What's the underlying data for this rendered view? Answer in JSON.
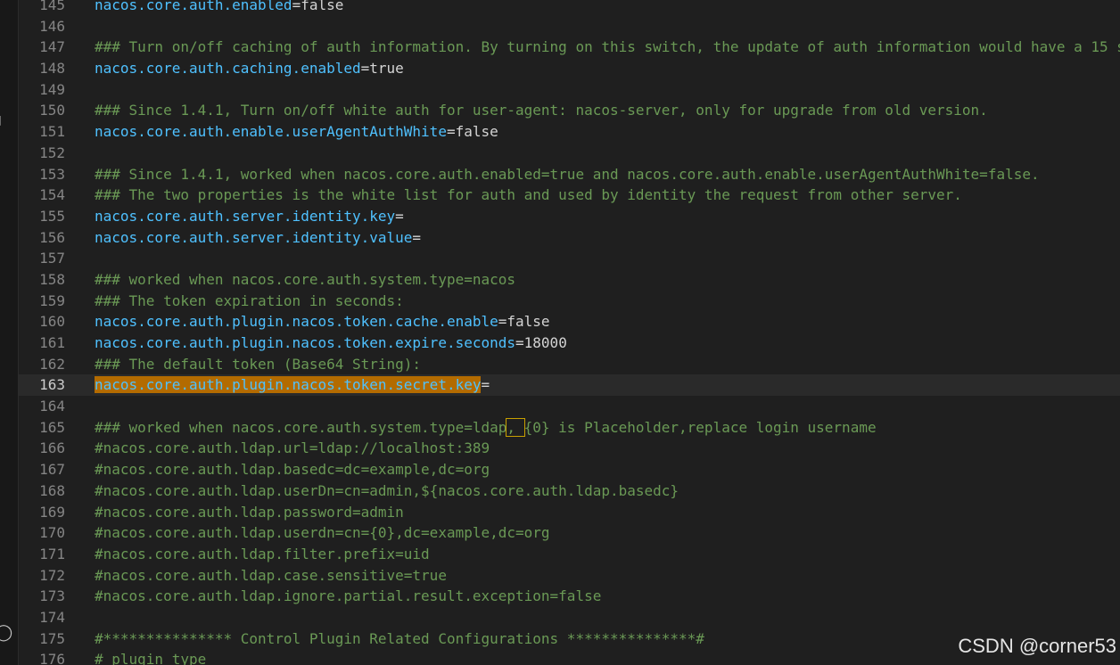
{
  "editor": {
    "current_line": "163",
    "lines": [
      {
        "n": "145",
        "parts": [
          {
            "t": "nacos.core.auth.enabled",
            "c": "k"
          },
          {
            "t": "=",
            "c": "eq"
          },
          {
            "t": "false",
            "c": "v"
          }
        ]
      },
      {
        "n": "146",
        "parts": []
      },
      {
        "n": "147",
        "parts": [
          {
            "t": "### Turn on/off caching of auth information. By turning on this switch, the update of auth information would have a 15 s",
            "c": "cm"
          }
        ]
      },
      {
        "n": "148",
        "parts": [
          {
            "t": "nacos.core.auth.caching.enabled",
            "c": "k"
          },
          {
            "t": "=",
            "c": "eq"
          },
          {
            "t": "true",
            "c": "v"
          }
        ]
      },
      {
        "n": "149",
        "parts": []
      },
      {
        "n": "150",
        "parts": [
          {
            "t": "### Since 1.4.1, Turn on/off white auth for user-agent: nacos-server, only for upgrade from old version.",
            "c": "cm"
          }
        ]
      },
      {
        "n": "151",
        "parts": [
          {
            "t": "nacos.core.auth.enable.userAgentAuthWhite",
            "c": "k"
          },
          {
            "t": "=",
            "c": "eq"
          },
          {
            "t": "false",
            "c": "v"
          }
        ]
      },
      {
        "n": "152",
        "parts": []
      },
      {
        "n": "153",
        "parts": [
          {
            "t": "### Since 1.4.1, worked when nacos.core.auth.enabled=true and nacos.core.auth.enable.userAgentAuthWhite=false.",
            "c": "cm"
          }
        ]
      },
      {
        "n": "154",
        "parts": [
          {
            "t": "### The two properties is the white list for auth and used by identity the request from other server.",
            "c": "cm"
          }
        ]
      },
      {
        "n": "155",
        "parts": [
          {
            "t": "nacos.core.auth.server.identity.key",
            "c": "k"
          },
          {
            "t": "=",
            "c": "eq"
          }
        ]
      },
      {
        "n": "156",
        "parts": [
          {
            "t": "nacos.core.auth.server.identity.value",
            "c": "k"
          },
          {
            "t": "=",
            "c": "eq"
          }
        ]
      },
      {
        "n": "157",
        "parts": []
      },
      {
        "n": "158",
        "parts": [
          {
            "t": "### worked when nacos.core.auth.system.type=nacos",
            "c": "cm"
          }
        ]
      },
      {
        "n": "159",
        "parts": [
          {
            "t": "### The token expiration in seconds:",
            "c": "cm"
          }
        ]
      },
      {
        "n": "160",
        "parts": [
          {
            "t": "nacos.core.auth.plugin.nacos.token.cache.enable",
            "c": "k"
          },
          {
            "t": "=",
            "c": "eq"
          },
          {
            "t": "false",
            "c": "v"
          }
        ]
      },
      {
        "n": "161",
        "parts": [
          {
            "t": "nacos.core.auth.plugin.nacos.token.expire.seconds",
            "c": "k"
          },
          {
            "t": "=",
            "c": "eq"
          },
          {
            "t": "18000",
            "c": "v"
          }
        ]
      },
      {
        "n": "162",
        "parts": [
          {
            "t": "### The default token (Base64 String):",
            "c": "cm"
          }
        ]
      },
      {
        "n": "163",
        "parts": [
          {
            "t": "nacos.core.auth.plugin.nacos.token.secret.key",
            "c": "k sel"
          },
          {
            "t": "=",
            "c": "eq"
          }
        ]
      },
      {
        "n": "164",
        "parts": []
      },
      {
        "n": "165",
        "parts": [
          {
            "t": "### worked when nacos.core.auth.system.type=ldap",
            "c": "cm"
          },
          {
            "t": ", ",
            "c": "cm bracket"
          },
          {
            "t": "{0} is Placeholder,replace login username",
            "c": "cm"
          }
        ]
      },
      {
        "n": "166",
        "parts": [
          {
            "t": "#nacos.core.auth.ldap.url=ldap://localhost:389",
            "c": "cm"
          }
        ]
      },
      {
        "n": "167",
        "parts": [
          {
            "t": "#nacos.core.auth.ldap.basedc=dc=example,dc=org",
            "c": "cm"
          }
        ]
      },
      {
        "n": "168",
        "parts": [
          {
            "t": "#nacos.core.auth.ldap.userDn=cn=admin,${nacos.core.auth.ldap.basedc}",
            "c": "cm"
          }
        ]
      },
      {
        "n": "169",
        "parts": [
          {
            "t": "#nacos.core.auth.ldap.password=admin",
            "c": "cm"
          }
        ]
      },
      {
        "n": "170",
        "parts": [
          {
            "t": "#nacos.core.auth.ldap.userdn=cn={0},dc=example,dc=org",
            "c": "cm"
          }
        ]
      },
      {
        "n": "171",
        "parts": [
          {
            "t": "#nacos.core.auth.ldap.filter.prefix=uid",
            "c": "cm"
          }
        ]
      },
      {
        "n": "172",
        "parts": [
          {
            "t": "#nacos.core.auth.ldap.case.sensitive=true",
            "c": "cm"
          }
        ]
      },
      {
        "n": "173",
        "parts": [
          {
            "t": "#nacos.core.auth.ldap.ignore.partial.result.exception=false",
            "c": "cm"
          }
        ]
      },
      {
        "n": "174",
        "parts": []
      },
      {
        "n": "175",
        "parts": [
          {
            "t": "#*************** Control Plugin Related Configurations ***************#",
            "c": "cm"
          }
        ]
      },
      {
        "n": "176",
        "parts": [
          {
            "t": "# plugin type",
            "c": "cm"
          }
        ]
      }
    ]
  },
  "watermark": "CSDN @corner53",
  "colors": {
    "background": "#1f1f1f",
    "key": "#4fc1ff",
    "comment": "#6a9955",
    "value": "#d4d4d4",
    "selection": "#b36b00",
    "line_number": "#858585"
  },
  "icons": [
    "chevron-right-icon",
    "chevron-right-icon",
    "file-icon",
    "account-icon"
  ]
}
